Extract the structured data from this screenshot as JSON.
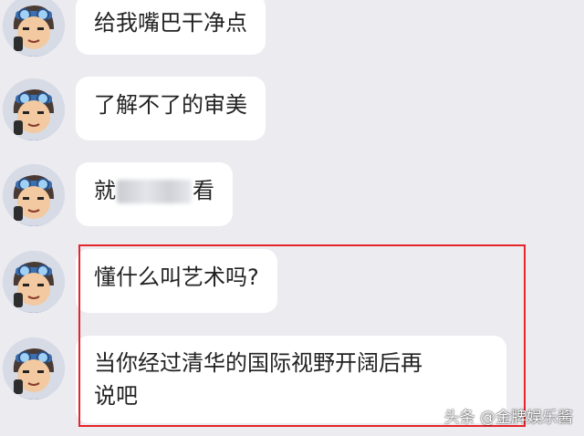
{
  "messages": [
    {
      "text": "给我嘴巴干净点"
    },
    {
      "text": "了解不了的审美"
    },
    {
      "text_before": "就",
      "text_after": "看"
    },
    {
      "text": "懂什么叫艺术吗?"
    },
    {
      "text_line1": "当你经过清华的国际视野开阔后再",
      "text_line2": "说吧"
    }
  ],
  "watermark": "头条 @金牌娱乐酱",
  "colors": {
    "background": "#ebebf0",
    "bubble": "#ffffff",
    "highlight": "#e5252c"
  }
}
